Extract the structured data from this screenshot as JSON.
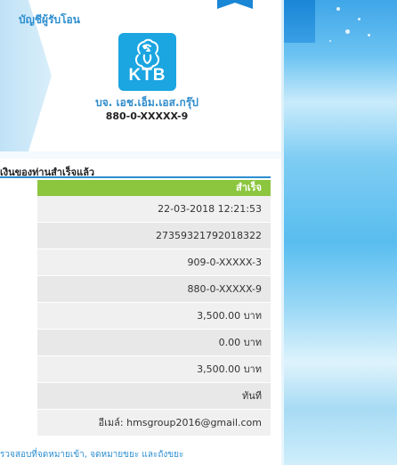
{
  "recipient": {
    "section_label": "บัญชีผู้รับโอน",
    "bank_logo_text": "KTB",
    "payee_name": "บจ. เอช.เอ็ม.เอส.กรุ๊ป",
    "payee_account": "880-0-XXXXX-9"
  },
  "result": {
    "section_title": "เงินของท่านสำเร็จแล้ว",
    "status": "สำเร็จ",
    "rows": [
      "22-03-2018 12:21:53",
      "27359321792018322",
      "909-0-XXXXX-3",
      "880-0-XXXXX-9",
      "3,500.00 บาท",
      "0.00 บาท",
      "3,500.00 บาท",
      "ทันที",
      "อีเมล์: hmsgroup2016@gmail.com"
    ]
  },
  "footer": {
    "note": "รวจสอบที่จดหมายเข้า, จดหมายขยะ และถังขยะ"
  },
  "colors": {
    "accent_blue": "#2d8fd0",
    "ktb_blue": "#1ba5e1",
    "success_green": "#8cc63f"
  }
}
